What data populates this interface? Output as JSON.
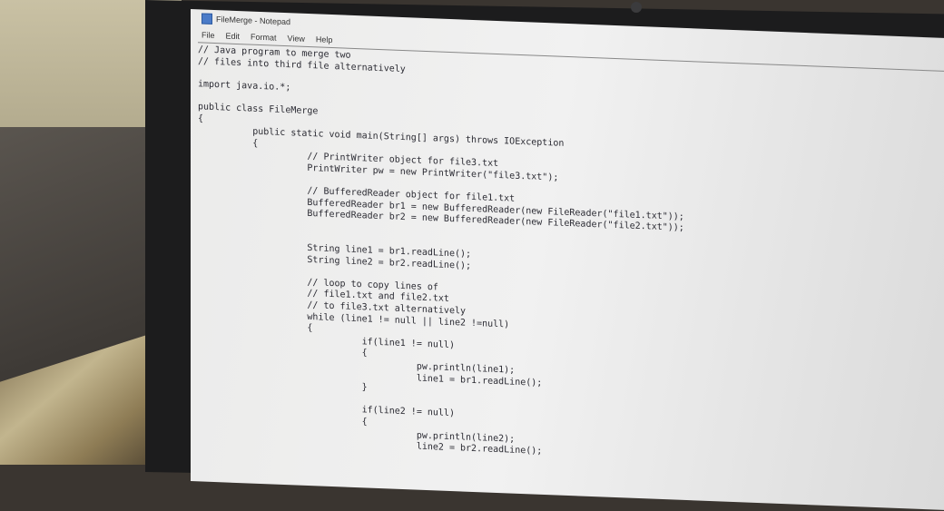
{
  "window": {
    "title": "FileMerge - Notepad"
  },
  "menu": [
    "File",
    "Edit",
    "Format",
    "View",
    "Help"
  ],
  "code_lines": [
    "// Java program to merge two",
    "// files into third file alternatively",
    "",
    "import java.io.*;",
    "",
    "public class FileMerge",
    "{",
    "          public static void main(String[] args) throws IOException",
    "          {",
    "                    // PrintWriter object for file3.txt",
    "                    PrintWriter pw = new PrintWriter(\"file3.txt\");",
    "",
    "                    // BufferedReader object for file1.txt",
    "                    BufferedReader br1 = new BufferedReader(new FileReader(\"file1.txt\"));",
    "                    BufferedReader br2 = new BufferedReader(new FileReader(\"file2.txt\"));",
    "",
    "",
    "                    String line1 = br1.readLine();",
    "                    String line2 = br2.readLine();",
    "",
    "                    // loop to copy lines of",
    "                    // file1.txt and file2.txt",
    "                    // to file3.txt alternatively",
    "                    while (line1 != null || line2 !=null)",
    "                    {",
    "                              if(line1 != null)",
    "                              {",
    "                                        pw.println(line1);",
    "                                        line1 = br1.readLine();",
    "                              }",
    "",
    "                              if(line2 != null)",
    "                              {",
    "                                        pw.println(line2);",
    "                                        line2 = br2.readLine();"
  ]
}
